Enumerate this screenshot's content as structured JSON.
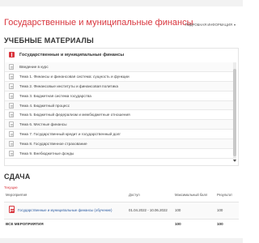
{
  "course": {
    "title": "Государственные и муниципальные финансы",
    "detail_link": "ПОДРОБНАЯ ИНФОРМАЦИЯ",
    "detail_icon": "chevron-down-icon"
  },
  "materials": {
    "section_title": "УЧЕБНЫЕ МАТЕРИАЛЫ",
    "header_label": "Государственные и муниципальные финансы",
    "topics": [
      "Введение в курс",
      "Тема 1. Финансы и финансовая система: сущность и функции",
      "Тема 2. Финансовые институты и финансовая политика",
      "Тема 3. Бюджетная система государства",
      "Тема 4. Бюджетный процесс",
      "Тема 5. Бюджетный федерализм и межбюджетные отношения",
      "Тема 6. Местные финансы",
      "Тема 7. Государственный кредит и государственный долг",
      "Тема 8. Государственное страхование",
      "Тема 9. Внебюджетные фонды"
    ]
  },
  "submission": {
    "section_title": "СДАЧА",
    "status_link": "Текущие",
    "columns": {
      "activity": "Мероприятия",
      "access": "Доступ",
      "max_score": "Максимальный балл",
      "result": "Результат"
    },
    "rows": [
      {
        "name": "Государственные и муниципальные финансы (обучение)",
        "access": "01.04.2022 - 10.06.2022",
        "max_score": "100",
        "result": "100"
      }
    ],
    "total": {
      "label": "ВСЕ МЕРОПРИЯТИЯ",
      "max_score": "100",
      "result": "100"
    }
  },
  "colors": {
    "accent": "#d9363e",
    "link": "#2a5aa0"
  }
}
